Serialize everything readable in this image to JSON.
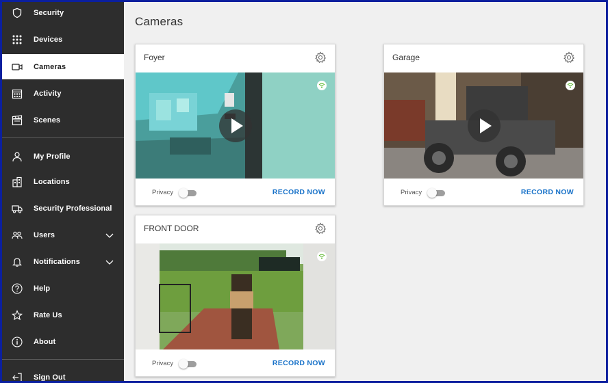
{
  "sidebar": {
    "items": [
      {
        "label": "Security",
        "icon": "shield-icon"
      },
      {
        "label": "Devices",
        "icon": "grid-icon"
      },
      {
        "label": "Cameras",
        "icon": "camera-icon",
        "active": true
      },
      {
        "label": "Activity",
        "icon": "calendar-icon"
      },
      {
        "label": "Scenes",
        "icon": "clapperboard-icon"
      },
      {
        "label": "My Profile",
        "icon": "user-icon"
      },
      {
        "label": "Locations",
        "icon": "building-icon"
      },
      {
        "label": "Security Professional",
        "icon": "truck-icon"
      },
      {
        "label": "Users",
        "icon": "users-icon",
        "expandable": true
      },
      {
        "label": "Notifications",
        "icon": "bell-icon",
        "expandable": true
      },
      {
        "label": "Help",
        "icon": "help-icon"
      },
      {
        "label": "Rate Us",
        "icon": "star-icon"
      },
      {
        "label": "About",
        "icon": "info-icon"
      },
      {
        "label": "Sign Out",
        "icon": "sign-out-icon"
      }
    ]
  },
  "main": {
    "title": "Cameras",
    "cameras": [
      {
        "name": "Foyer",
        "privacy_label": "Privacy",
        "record_label": "RECORD NOW",
        "privacy_on": false
      },
      {
        "name": "Garage",
        "privacy_label": "Privacy",
        "record_label": "RECORD NOW",
        "privacy_on": false
      },
      {
        "name": "FRONT DOOR",
        "privacy_label": "Privacy",
        "record_label": "RECORD NOW",
        "privacy_on": false
      }
    ]
  },
  "colors": {
    "sidebar_bg": "#2d2d2d",
    "accent": "#1a73c9",
    "wifi_green": "#5cb82e",
    "frame_border": "#0b1f9e"
  }
}
